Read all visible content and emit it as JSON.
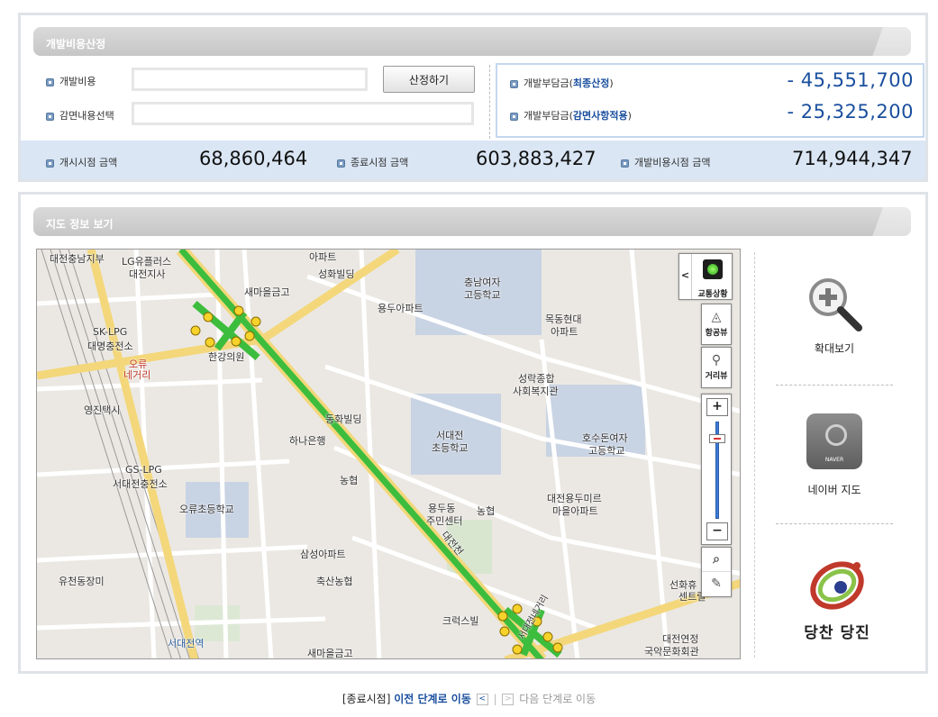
{
  "cost_section": {
    "title": "개발비용산정",
    "dev_cost_label": "개발비용",
    "dev_cost_value": "",
    "calc_button": "산정하기",
    "reduction_label": "감면내용선택",
    "reduction_value": "",
    "burden_final_prefix": "개발부담금(",
    "burden_final_emph": "최종산정",
    "burden_final_suffix": ")",
    "burden_final_value": "- 45,551,700",
    "burden_reduced_prefix": "개발부담금(",
    "burden_reduced_emph": "감면사항적용",
    "burden_reduced_suffix": ")",
    "burden_reduced_value": "- 25,325,200",
    "start_label": "개시시점 금액",
    "start_value": "68,860,464",
    "end_label": "종료시점 금액",
    "end_value": "603,883,427",
    "dev_point_label": "개발비용시점 금액",
    "dev_point_value": "714,944,347"
  },
  "map_section": {
    "title": "지도 정보 보기",
    "controls": {
      "traffic": "교통상황",
      "collapse": "<",
      "aerial": "항공뷰",
      "street": "거리뷰",
      "zoom_in": "+",
      "zoom_out": "−"
    },
    "labels": [
      "대전충남지부",
      "LG유플러스",
      "대전지사",
      "아파트",
      "성화빌딩",
      "새마을금고",
      "충남여자",
      "고등학교",
      "용두아파트",
      "목동현대",
      "아파트",
      "SK-LPG",
      "대명충전소",
      "오류",
      "네거리",
      "한강의원",
      "성락종합",
      "사회복지관",
      "영진택시",
      "동화빌딩",
      "하나은행",
      "서대전",
      "초등학교",
      "호수돈여자",
      "고등학교",
      "GS-LPG",
      "서대전충전소",
      "농협",
      "오류초등학교",
      "용두동",
      "주민센터",
      "농협",
      "대전용두미르",
      "마을아파트",
      "대전천",
      "삼성아파트",
      "축산농협",
      "유천동장미",
      "크럭스빌",
      "선화휴",
      "센트럴",
      "서대전역",
      "새마을금고",
      "대전연정",
      "국악문화회관",
      "서대전네거리"
    ],
    "side": {
      "zoom_label": "확대보기",
      "naver_label": "네이버 지도",
      "naver_mark": "NAVER",
      "logo_text": "당찬 당진"
    }
  },
  "footer_nav": {
    "end_point": "[종료시점]",
    "prev_label": "이전 단계로 이동",
    "prev_arrow": "<",
    "sep": "|",
    "next_arrow": ">",
    "next_label": "다음 단계로 이동"
  },
  "colors": {
    "accent_blue": "#1a4f9e",
    "band_blue": "#dae6f4",
    "route_green": "#3dbd3d",
    "road_yellow": "#f7e08a"
  }
}
